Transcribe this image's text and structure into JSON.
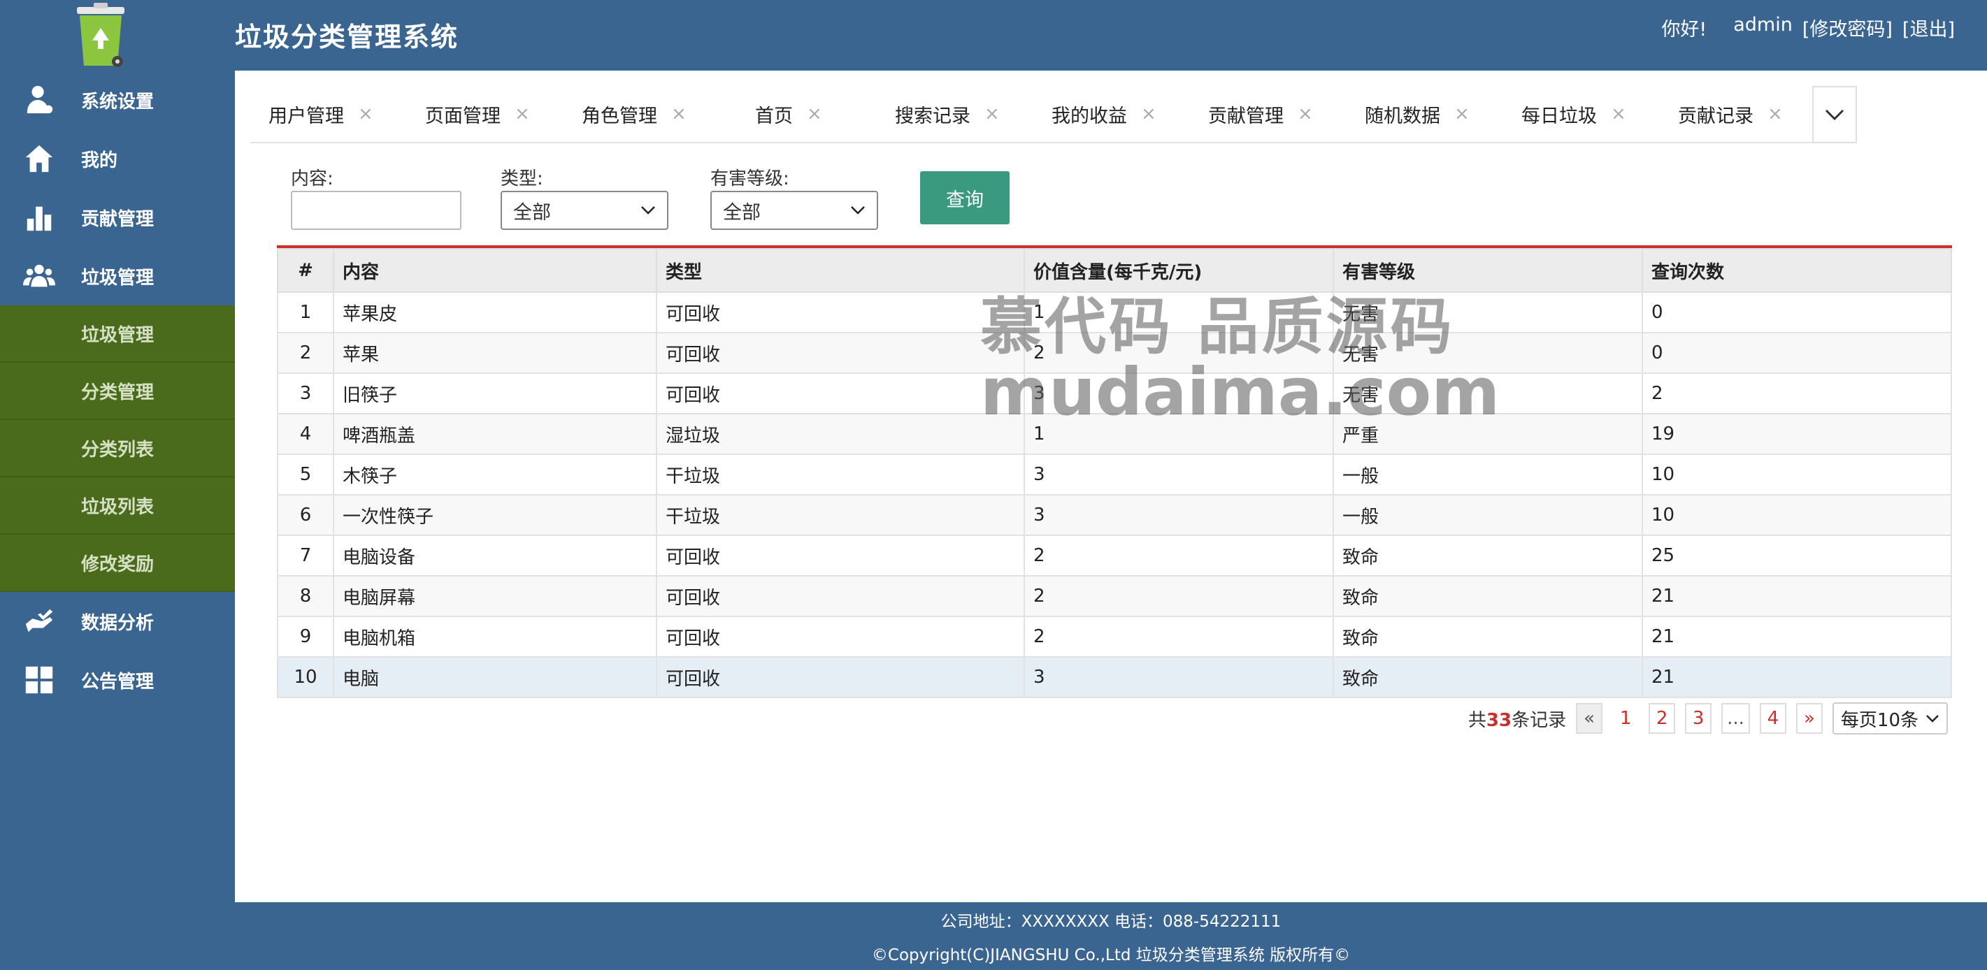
{
  "header": {
    "title": "垃圾分类管理系统",
    "greeting": "你好!",
    "username": "admin",
    "change_password": "[修改密码]",
    "logout": "[退出]"
  },
  "sidebar": {
    "items": [
      {
        "label": "系统设置",
        "icon": "user-gear-icon"
      },
      {
        "label": "我的",
        "icon": "home-icon"
      },
      {
        "label": "贡献管理",
        "icon": "bar-chart-icon"
      },
      {
        "label": "垃圾管理",
        "icon": "users-icon"
      }
    ],
    "sub_items": [
      "垃圾管理",
      "分类管理",
      "分类列表",
      "垃圾列表",
      "修改奖励"
    ],
    "items_after": [
      {
        "label": "数据分析",
        "icon": "hand-check-icon"
      },
      {
        "label": "公告管理",
        "icon": "grid-icon"
      }
    ]
  },
  "tabs": [
    "用户管理",
    "页面管理",
    "角色管理",
    "首页",
    "搜索记录",
    "我的收益",
    "贡献管理",
    "随机数据",
    "每日垃圾",
    "贡献记录"
  ],
  "tab_close": "×",
  "filter": {
    "content_label": "内容:",
    "content_value": "",
    "type_label": "类型:",
    "type_value": "全部",
    "harm_label": "有害等级:",
    "harm_value": "全部",
    "query_button": "查询"
  },
  "table": {
    "columns": [
      "#",
      "内容",
      "类型",
      "价值含量(每千克/元)",
      "有害等级",
      "查询次数"
    ],
    "rows": [
      [
        "1",
        "苹果皮",
        "可回收",
        "1",
        "无害",
        "0"
      ],
      [
        "2",
        "苹果",
        "可回收",
        "2",
        "无害",
        "0"
      ],
      [
        "3",
        "旧筷子",
        "可回收",
        "3",
        "无害",
        "2"
      ],
      [
        "4",
        "啤酒瓶盖",
        "湿垃圾",
        "1",
        "严重",
        "19"
      ],
      [
        "5",
        "木筷子",
        "干垃圾",
        "3",
        "一般",
        "10"
      ],
      [
        "6",
        "一次性筷子",
        "干垃圾",
        "3",
        "一般",
        "10"
      ],
      [
        "7",
        "电脑设备",
        "可回收",
        "2",
        "致命",
        "25"
      ],
      [
        "8",
        "电脑屏幕",
        "可回收",
        "2",
        "致命",
        "21"
      ],
      [
        "9",
        "电脑机箱",
        "可回收",
        "2",
        "致命",
        "21"
      ],
      [
        "10",
        "电脑",
        "可回收",
        "3",
        "致命",
        "21"
      ]
    ]
  },
  "pagination": {
    "prefix": "共",
    "total": "33",
    "suffix": "条记录",
    "prev": "«",
    "pages": [
      "1",
      "2",
      "3",
      "...",
      "4"
    ],
    "next": "»",
    "per_page": "每页10条"
  },
  "watermark": {
    "line1": "慕代码 品质源码",
    "line2": "mudaima.com"
  },
  "footer": {
    "line1": "公司地址：XXXXXXXX 电话：088-54222111",
    "line2": "©Copyright(C)JIANGSHU Co.,Ltd 垃圾分类管理系统 版权所有©"
  },
  "colors": {
    "primary": "#3b6591",
    "submenu": "#4a6a1c",
    "accent_red": "#c9302c",
    "button_teal": "#3a9a7f"
  }
}
